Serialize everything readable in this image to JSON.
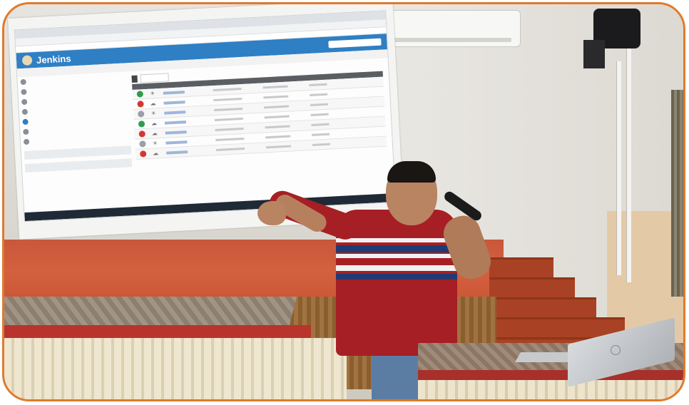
{
  "scene": {
    "description_hidden": "",
    "border_color": "#e07a2c"
  },
  "projection": {
    "app_title": "Jenkins",
    "colors": {
      "header_blue": "#2f7fc4",
      "success": "#2e9d4b",
      "failure": "#d33833",
      "disabled": "#9aa0a6"
    },
    "jobs": [
      {
        "status": "success",
        "weather": "sun"
      },
      {
        "status": "failure",
        "weather": "cloud"
      },
      {
        "status": "disabled",
        "weather": "sun"
      },
      {
        "status": "success",
        "weather": "cloud"
      },
      {
        "status": "failure",
        "weather": "cloud"
      },
      {
        "status": "disabled",
        "weather": "sun"
      },
      {
        "status": "failure",
        "weather": "cloud"
      }
    ]
  }
}
